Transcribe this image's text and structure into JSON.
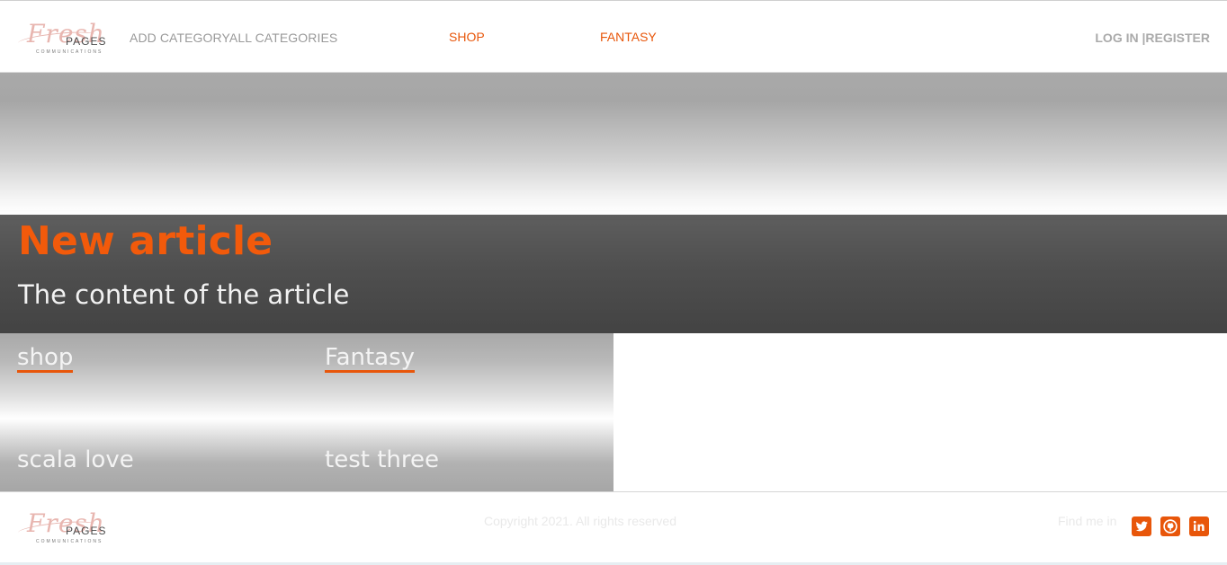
{
  "header": {
    "logo_script": "Fresh",
    "logo_word": "PAGES",
    "logo_sub": "COMMUNICATIONS",
    "nav_add_category": "ADD CATEGORY",
    "nav_all_categories": "ALL CATEGORIES",
    "nav_shop": "SHOP",
    "nav_fantasy": "FANTASY",
    "login": "LOG IN",
    "separator": "|",
    "register": "REGISTER"
  },
  "article": {
    "title": "New article",
    "content": "The content of the article"
  },
  "categories": [
    {
      "label": "shop"
    },
    {
      "label": "Fantasy"
    },
    {
      "label": "scala love"
    },
    {
      "label": "test three"
    }
  ],
  "footer": {
    "logo_script": "Fresh",
    "logo_word": "PAGES",
    "logo_sub": "COMMUNICATIONS",
    "copyright": "Copyright 2021. All rights reserved",
    "find_me": "Find me in",
    "social_icons": [
      "twitter-icon",
      "github-icon",
      "linkedin-icon"
    ]
  },
  "colors": {
    "accent": "#e8560a",
    "title_orange": "#f25a0b",
    "nav_gray": "#9a9a9a"
  }
}
